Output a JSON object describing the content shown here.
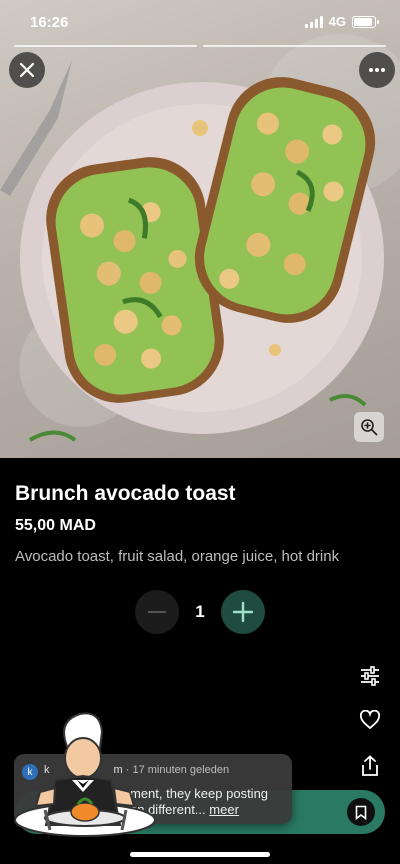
{
  "status_bar": {
    "time": "16:26",
    "network": "4G",
    "battery_percent": 92
  },
  "hero": {
    "image_subject": "avocado toast with chickpeas on a pink plate"
  },
  "product": {
    "title": "Brunch avocado toast",
    "price": "55,00 MAD",
    "description": "Avocado toast, fruit salad, orange juice, hot drink"
  },
  "quantity": {
    "value": "1"
  },
  "review": {
    "avatar_letter": "k",
    "author_prefix": "k",
    "author_suffix": "m",
    "time_ago": "· 17 minuten geleden",
    "text_line1": "ment, they keep posting",
    "text_line2": "on different...",
    "more_label": "meer"
  },
  "colors": {
    "accent": "#2a7a63",
    "plus_button": "#1f4b40",
    "background": "#000000"
  },
  "icons": [
    "close-icon",
    "more-icon",
    "zoom-in-icon",
    "minus-icon",
    "plus-icon",
    "filter-icon",
    "heart-icon",
    "share-icon",
    "bookmark-icon",
    "waiter-sticker"
  ]
}
